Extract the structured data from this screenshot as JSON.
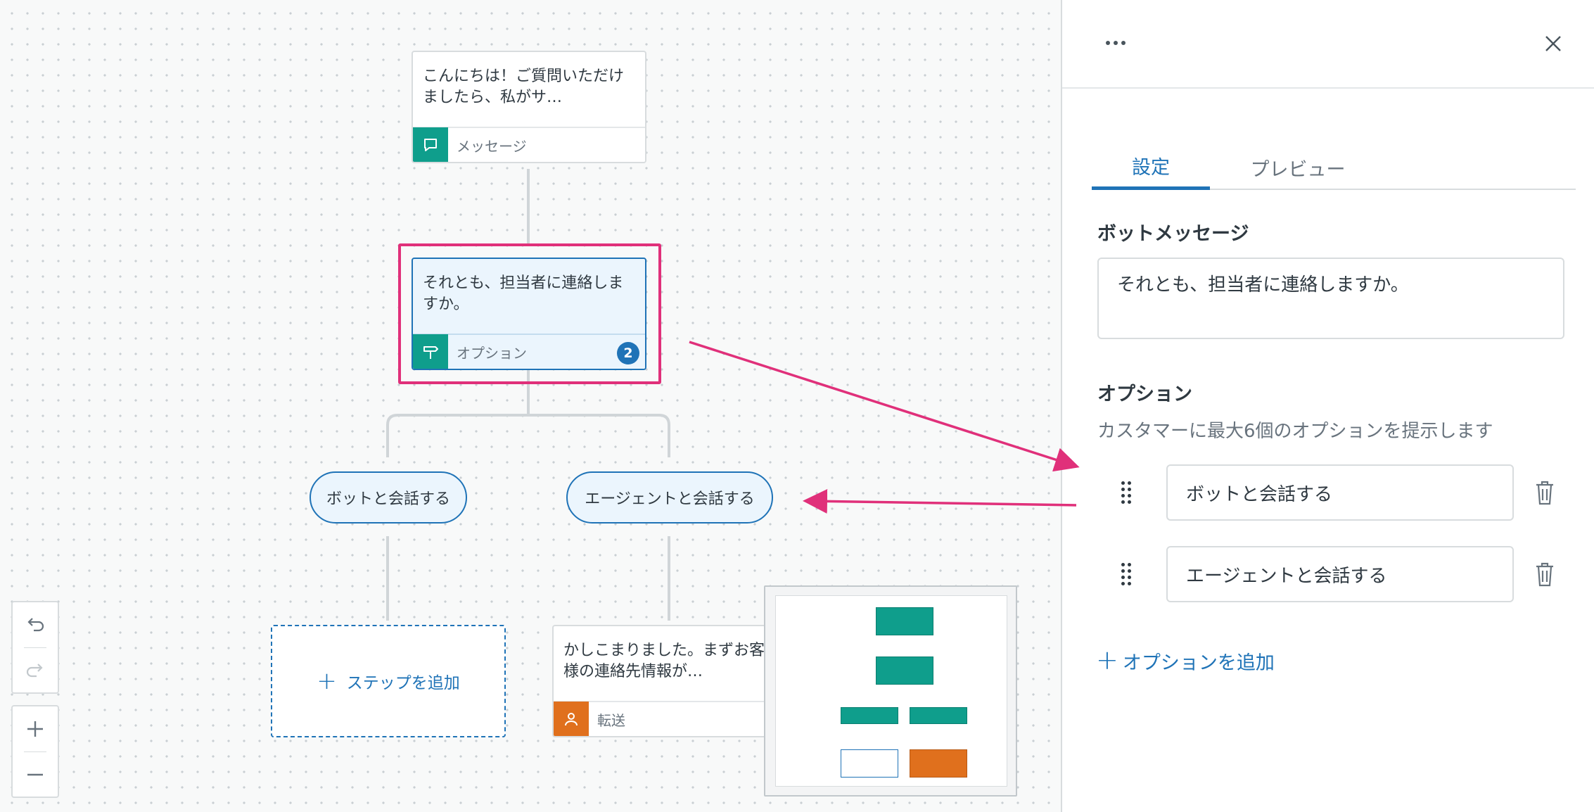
{
  "canvas": {
    "nodes": [
      {
        "text": "こんにちは！ご質問いただけましたら、私がサ…",
        "type_label": "メッセージ"
      },
      {
        "text": "それとも、担当者に連絡しますか。",
        "type_label": "オプション",
        "badge": "2"
      },
      {
        "text": "かしこまりました。まずお客様の連絡先情報が…",
        "type_label": "転送"
      }
    ],
    "options": [
      "ボットと会話する",
      "エージェントと会話する"
    ],
    "add_step_label": "ステップを追加"
  },
  "panel": {
    "tabs": [
      {
        "label": "設定",
        "active": true
      },
      {
        "label": "プレビュー",
        "active": false
      }
    ],
    "bot_message_title": "ボットメッセージ",
    "bot_message_value": "それとも、担当者に連絡しますか。",
    "options_title": "オプション",
    "options_hint": "カスタマーに最大6個のオプションを提示します",
    "options": [
      {
        "value": "ボットと会話する"
      },
      {
        "value": "エージェントと会話する"
      }
    ],
    "add_option_label": "オプションを追加"
  },
  "colors": {
    "accent": "#1f73b7",
    "message_icon": "#0f9e8c",
    "transfer_icon": "#e0701d",
    "highlight": "#e0307a"
  },
  "icons": {
    "message": "speech-bubble-icon",
    "options": "signpost-icon",
    "transfer": "person-icon",
    "undo": "undo-icon",
    "redo": "redo-icon",
    "zoom_in": "plus-icon",
    "zoom_out": "minus-icon",
    "more": "more-horizontal-icon",
    "close": "close-icon",
    "drag": "grip-icon",
    "delete": "trash-icon"
  }
}
